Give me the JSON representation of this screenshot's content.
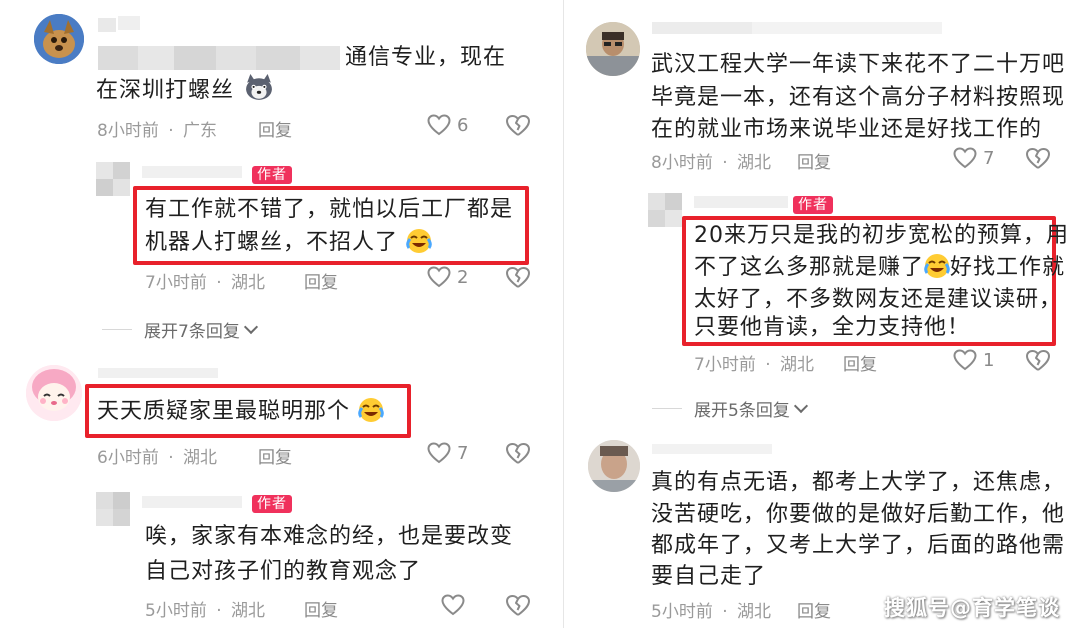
{
  "left": {
    "c1": {
      "text_line1": "通信专业，现在",
      "text_line2": "在深圳打螺丝",
      "time": "8小时前",
      "region": "广东",
      "reply": "回复",
      "likes": "6"
    },
    "r1": {
      "badge": "作者",
      "text_line1": "有工作就不错了，就怕以后工厂都是",
      "text_line2": "机器人打螺丝，不招人了",
      "time": "7小时前",
      "region": "湖北",
      "reply": "回复",
      "likes": "2"
    },
    "expand1": "展开7条回复",
    "c2": {
      "text": "天天质疑家里最聪明那个",
      "time": "6小时前",
      "region": "湖北",
      "reply": "回复",
      "likes": "7"
    },
    "r2": {
      "badge": "作者",
      "text_line1": "唉，家家有本难念的经，也是要改变",
      "text_line2": "自己对孩子们的教育观念了",
      "time": "5小时前",
      "region": "湖北",
      "reply": "回复"
    }
  },
  "right": {
    "c1": {
      "text_line1": "武汉工程大学一年读下来花不了二十万吧",
      "text_line2": "毕竟是一本，还有这个高分子材料按照现",
      "text_line3": "在的就业市场来说毕业还是好找工作的",
      "time": "8小时前",
      "region": "湖北",
      "reply": "回复",
      "likes": "7"
    },
    "r1": {
      "badge": "作者",
      "text_line1": "20来万只是我的初步宽松的预算，用",
      "text_line2a": "不了这么多那就是赚了",
      "text_line2b": "好找工作就",
      "text_line3": "太好了，不多数网友还是建议读研，",
      "text_line4": "只要他肯读，全力支持他！",
      "time": "7小时前",
      "region": "湖北",
      "reply": "回复",
      "likes": "1"
    },
    "expand1": "展开5条回复",
    "c2": {
      "text_line1": "真的有点无语，都考上大学了，还焦虑，",
      "text_line2": "没苦硬吃，你要做的是做好后勤工作，他",
      "text_line3": "都成年了，又考上大学了，后面的路他需",
      "text_line4": "要自己走了",
      "time": "5小时前",
      "region": "湖北",
      "reply": "回复"
    }
  },
  "meta_separator": "·",
  "watermark": "搜狐号@育学笔谈",
  "icons": [
    "heart-outline-icon",
    "broken-heart-icon",
    "cry-laugh-emoji",
    "husky-emoji",
    "chevron-down-icon"
  ],
  "colors": {
    "author_badge": "#f0315c",
    "highlight_box": "#e8212b",
    "meta_text": "#9a9a9a"
  }
}
